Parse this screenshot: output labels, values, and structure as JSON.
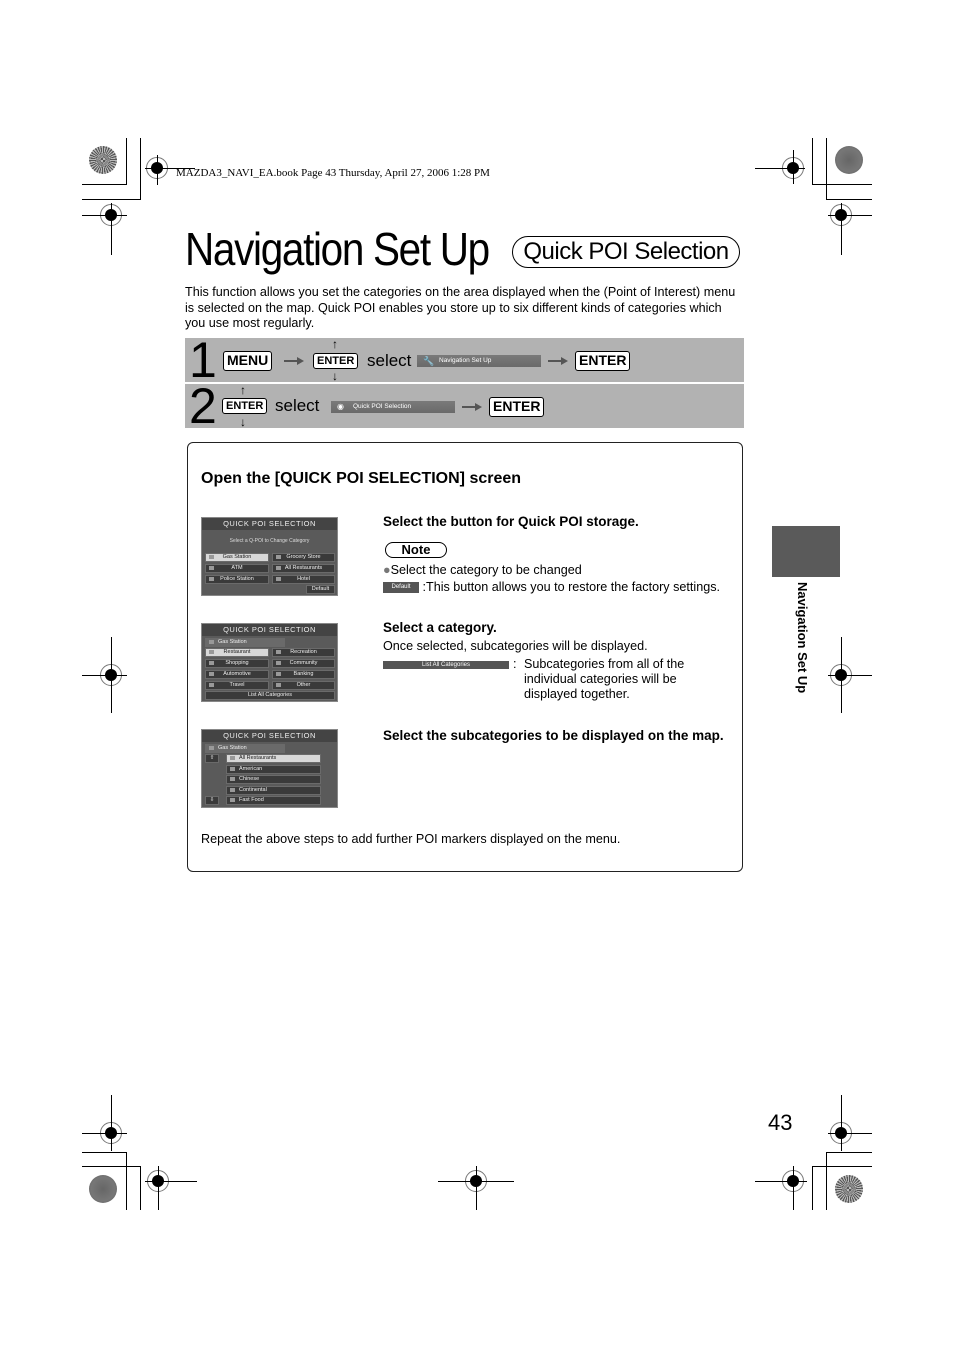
{
  "header_meta": "MAZDA3_NAVI_EA.book  Page 43  Thursday, April 27, 2006  1:28 PM",
  "title": "Navigation Set Up",
  "subtitle": "Quick POI Selection",
  "intro": "This function allows you set the categories on the area displayed when the (Point of Interest) menu is selected on the map. Quick POI enables you store up to six different kinds of categories which you use most regularly.",
  "steps": [
    {
      "number": "1",
      "keys": {
        "menu": "MENU",
        "enter_small": "ENTER",
        "enter": "ENTER"
      },
      "select_word": "select",
      "menu_item": "Navigation Set Up",
      "menu_item_icon": "wrench-icon"
    },
    {
      "number": "2",
      "keys": {
        "enter_small": "ENTER",
        "enter": "ENTER"
      },
      "select_word": "select",
      "menu_item": "Quick POI Selection",
      "menu_item_icon": "camera-icon"
    }
  ],
  "panel": {
    "heading": "Open the [QUICK POI SELECTION] screen",
    "screens": [
      {
        "title": "QUICK POI SELECTION",
        "prompt": "Select a Q-POI to Change Category",
        "buttons": [
          "Gas Station",
          "Grocery Store",
          "ATM",
          "All Restaurants",
          "Police Station",
          "Hotel"
        ],
        "default_label": "Default"
      },
      {
        "title": "QUICK POI SELECTION",
        "current": "Gas Station",
        "buttons": [
          "Restaurant",
          "Recreation",
          "Shopping",
          "Community",
          "Automotive",
          "Banking",
          "Travel",
          "Other"
        ],
        "list_all": "List All Categories"
      },
      {
        "title": "QUICK POI SELECTION",
        "current": "Gas Station",
        "items": [
          "All Restaurants",
          "American",
          "Chinese",
          "Continental",
          "Fast Food"
        ]
      }
    ],
    "instructions": [
      {
        "heading": "Select the button for Quick POI storage.",
        "note_label": "Note",
        "note_bullet": "Select the category to be changed",
        "default_chip": "Default",
        "default_desc": ":This button allows you to restore the factory settings."
      },
      {
        "heading": "Select a category.",
        "body": "Once selected, subcategories will be displayed.",
        "list_chip": "List All Categories",
        "list_desc_colon": ":",
        "list_desc": "Subcategories from all of the individual categories will be displayed together."
      },
      {
        "heading": "Select the subcategories to be displayed on the map."
      }
    ],
    "footer": "Repeat the above steps to add further POI markers displayed on the menu."
  },
  "side_tab": "Navigation Set Up",
  "page_number": "43"
}
